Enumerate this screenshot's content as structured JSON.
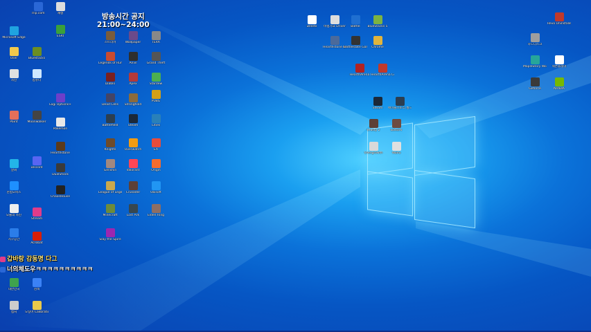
{
  "notice": {
    "line1": "방송시간 공지",
    "line2": "21:00~24:00"
  },
  "overlay": {
    "line1": "갑바랑 감동명 다그",
    "line2": "너의체도우ㅋㅋㅋㅋㅋㅋㅋㅋㅋㅋ"
  },
  "colors": {
    "desktop": "#0b72d9",
    "logo": "#7fd8ff"
  },
  "icons": [
    {
      "label": "Trip.com",
      "color": "#2a67d6"
    },
    {
      "label": "재생",
      "color": "#dddddd"
    },
    {
      "label": "Microsoft Edge",
      "color": "#1fa3e0"
    },
    {
      "label": "ESRI",
      "color": "#3aa03a"
    },
    {
      "label": "User",
      "color": "#f2c94c"
    },
    {
      "label": "Bluestacks",
      "color": "#6b8e23"
    },
    {
      "label": "사진",
      "color": "#e0e0e0"
    },
    {
      "label": "컴퓨터",
      "color": "#cfe8ff"
    },
    {
      "label": "Logi Options+",
      "color": "#6d3fc9"
    },
    {
      "label": "Paint",
      "color": "#e36f5a"
    },
    {
      "label": "Moonwalker",
      "color": "#444444"
    },
    {
      "label": "Pokemon",
      "color": "#e8e8e8"
    },
    {
      "label": "Discord",
      "color": "#5865f2"
    },
    {
      "label": "Hearthstone",
      "color": "#5b3a1b"
    },
    {
      "label": "알씨",
      "color": "#23b5e8"
    },
    {
      "label": "DualShock",
      "color": "#3a3a3a"
    },
    {
      "label": "한컴오피스",
      "color": "#1e90ff"
    },
    {
      "label": "ChaosHouse",
      "color": "#222222"
    },
    {
      "label": "오늘의 사진",
      "color": "#eeeeee"
    },
    {
      "label": "Stream",
      "color": "#e03c8a"
    },
    {
      "label": "지구공간",
      "color": "#2b7de9"
    },
    {
      "label": "Acrobat",
      "color": "#d81e05"
    },
    {
      "label": "대한민국",
      "color": "#3fa34d"
    },
    {
      "label": "검색",
      "color": "#3b82f6"
    },
    {
      "label": "캡처",
      "color": "#cccccc"
    },
    {
      "label": "오징어 Calibration",
      "color": "#e8c94a"
    },
    {
      "label": "스트리머",
      "color": "#7a5c3b"
    },
    {
      "label": "Wallpaper",
      "color": "#6b4a8a"
    },
    {
      "label": "TERA",
      "color": "#888888"
    },
    {
      "label": "Legends of Runeterra",
      "color": "#c84b31"
    },
    {
      "label": "Anvil",
      "color": "#2e2e2e"
    },
    {
      "label": "Grand Theft",
      "color": "#555555"
    },
    {
      "label": "Diablo",
      "color": "#7a2020"
    },
    {
      "label": "Apex",
      "color": "#b33a3a"
    },
    {
      "label": "Stardew",
      "color": "#4caf50"
    },
    {
      "label": "Dead Cells",
      "color": "#444466"
    },
    {
      "label": "Stronghold",
      "color": "#8b6b3d"
    },
    {
      "label": "PUBG",
      "color": "#d4a017"
    },
    {
      "label": "Battlefield",
      "color": "#2c3e50"
    },
    {
      "label": "Steam",
      "color": "#1b2838"
    },
    {
      "label": "Cities",
      "color": "#2980b9"
    },
    {
      "label": "Knights",
      "color": "#6e4b2a"
    },
    {
      "label": "Overwatch",
      "color": "#f39c12"
    },
    {
      "label": "EA",
      "color": "#e74c3c"
    },
    {
      "label": "Genshin",
      "color": "#a1887f"
    },
    {
      "label": "Valorant",
      "color": "#ff4655"
    },
    {
      "label": "Origin",
      "color": "#f56c2d"
    },
    {
      "label": "League of Legends",
      "color": "#c9a84c"
    },
    {
      "label": "Crusader",
      "color": "#5d4037"
    },
    {
      "label": "Ubisoft",
      "color": "#2196f3"
    },
    {
      "label": "Minecraft",
      "color": "#6d8b3a"
    },
    {
      "label": "Lost Ark",
      "color": "#37474f"
    },
    {
      "label": "Elden Ring",
      "color": "#8d6e63"
    },
    {
      "label": "Slay the Spire",
      "color": "#9c27b0"
    },
    {
      "label": "Kingdoms",
      "color": "#795548"
    },
    {
      "label": "Age of Empires",
      "color": "#bf8040"
    },
    {
      "label": "Civilization",
      "color": "#3f51b5"
    },
    {
      "label": "XCOM",
      "color": "#263238"
    },
    {
      "label": "Hades",
      "color": "#c62828"
    },
    {
      "label": "Terraria",
      "color": "#43a047"
    },
    {
      "label": "Rimworld",
      "color": "#6d4c41"
    },
    {
      "label": "Factorio",
      "color": "#ef6c00"
    },
    {
      "label": "Darkest Dungeon",
      "color": "#212121"
    },
    {
      "label": "Dota 2",
      "color": "#b71c1c"
    },
    {
      "label": "Rust",
      "color": "#d84315"
    },
    {
      "label": "Don't Starve",
      "color": "#4e342e"
    },
    {
      "label": "Cuphead",
      "color": "#fbc02d"
    },
    {
      "label": "Celeste",
      "color": "#e91e63"
    },
    {
      "label": "Hollow Knight",
      "color": "#37474f"
    },
    {
      "label": "Among Us",
      "color": "#d32f2f"
    },
    {
      "label": "Fall Guys",
      "color": "#ab47bc"
    },
    {
      "label": "Portal",
      "color": "#0288d1"
    },
    {
      "label": "Half-Life",
      "color": "#ff6f00"
    },
    {
      "label": "Left 4 Dead",
      "color": "#5d4037"
    },
    {
      "label": "Garry's Mod",
      "color": "#1565c0"
    },
    {
      "label": "Counter-Strike",
      "color": "#f9a825"
    },
    {
      "label": "Team Fortress",
      "color": "#bf360c"
    },
    {
      "label": "Starcraft",
      "color": "#1a237e"
    },
    {
      "label": "Warcraft",
      "color": "#4e342e"
    },
    {
      "label": "Guild Wars",
      "color": "#880e4f"
    },
    {
      "label": "Blade & Soul",
      "color": "#283593"
    },
    {
      "label": "Monster Hunter",
      "color": "#3e2723"
    },
    {
      "label": "Geforce",
      "color": "#76b900"
    },
    {
      "label": "OBS Studio",
      "color": "#302e31"
    },
    {
      "label": "Delete",
      "color": "#ffffff"
    },
    {
      "label": "비행기표 Driver",
      "color": "#dddddd"
    },
    {
      "label": "Battle",
      "color": "#1f6fd1"
    },
    {
      "label": "BlueStacks 5",
      "color": "#7cb342"
    },
    {
      "label": "Hearthstone Deck Tracker",
      "color": "#4b6a9b"
    },
    {
      "label": "Battlestate Games L.",
      "color": "#333333"
    },
    {
      "label": "Chrome",
      "color": "#e0b43c"
    },
    {
      "label": "HearthArena",
      "color": "#b22222"
    },
    {
      "label": "HearthArena Companion",
      "color": "#c0392b"
    },
    {
      "label": "Steam",
      "color": "#1b2838"
    },
    {
      "label": "메이플스토리 월드",
      "color": "#2c3e50"
    },
    {
      "label": "Crusty 2",
      "color": "#5d4037"
    },
    {
      "label": "Lostark",
      "color": "#6d4c41"
    },
    {
      "label": "Overgrowth",
      "color": "#d9d9d9"
    },
    {
      "label": "Waifu",
      "color": "#e0e0e0"
    },
    {
      "label": "Revo Uninstaller",
      "color": "#c0392b"
    },
    {
      "label": "하드디스크",
      "color": "#9e9e9e"
    },
    {
      "label": "MapleStory Worlds",
      "color": "#26a69a"
    },
    {
      "label": "넥슨플레이",
      "color": "#ffffff"
    },
    {
      "label": "Geforce",
      "color": "#3a3a3a"
    },
    {
      "label": "NVIDIA",
      "color": "#76b900"
    }
  ]
}
